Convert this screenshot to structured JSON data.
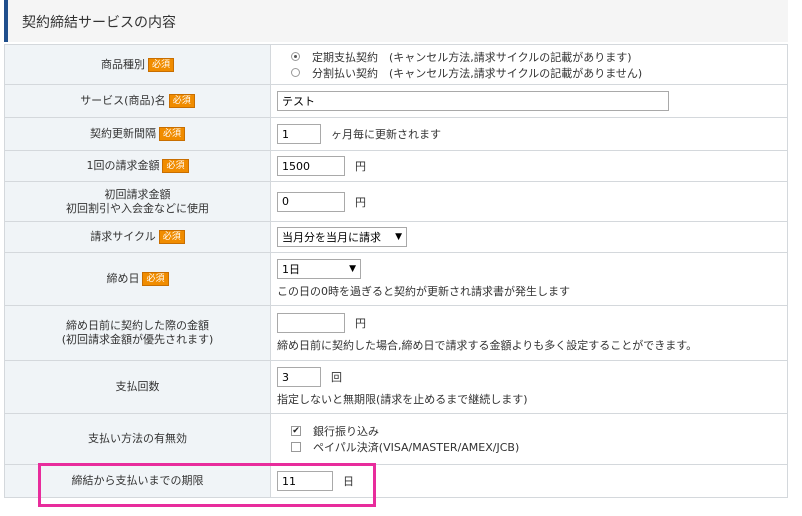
{
  "section_title": "契約締結サービスの内容",
  "required_badge": "必須",
  "colors": {
    "highlight": "#e82c9c",
    "accent": "#1f4e8c",
    "badge": "#f08c00"
  },
  "product_type": {
    "label": "商品種別",
    "options": [
      {
        "label": "定期支払契約　(キャンセル方法,請求サイクルの記載があります)",
        "selected": true
      },
      {
        "label": "分割払い契約　(キャンセル方法,請求サイクルの記載がありません)",
        "selected": false
      }
    ]
  },
  "service_name": {
    "label": "サービス(商品)名",
    "value": "テスト"
  },
  "renewal_interval": {
    "label": "契約更新間隔",
    "value": "1",
    "unit": "ヶ月毎に更新されます"
  },
  "billing_amount": {
    "label": "1回の請求金額",
    "value": "1500",
    "unit": "円"
  },
  "initial_amount": {
    "label_line1": "初回請求金額",
    "label_line2": "初回割引や入会金などに使用",
    "value": "0",
    "unit": "円"
  },
  "billing_cycle": {
    "label": "請求サイクル",
    "value": "当月分を当月に請求"
  },
  "closing_day": {
    "label": "締め日",
    "value": "1日",
    "note": "この日の0時を過ぎると契約が更新され請求書が発生します"
  },
  "pre_closing_amount": {
    "label_line1": "締め日前に契約した際の金額",
    "label_line2": "(初回請求金額が優先されます)",
    "value": "",
    "unit": "円",
    "note": "締め日前に契約した場合,締め日で請求する金額よりも多く設定することができます。"
  },
  "payment_count": {
    "label": "支払回数",
    "value": "3",
    "unit": "回",
    "note": "指定しないと無期限(請求を止めるまで継続します)"
  },
  "payment_methods": {
    "label": "支払い方法の有無効",
    "options": [
      {
        "label": "銀行振り込み",
        "checked": true
      },
      {
        "label": "ペイパル決済(VISA/MASTER/AMEX/JCB)",
        "checked": false
      }
    ]
  },
  "payment_deadline": {
    "label": "締結から支払いまでの期限",
    "value": "11",
    "unit": "日"
  }
}
